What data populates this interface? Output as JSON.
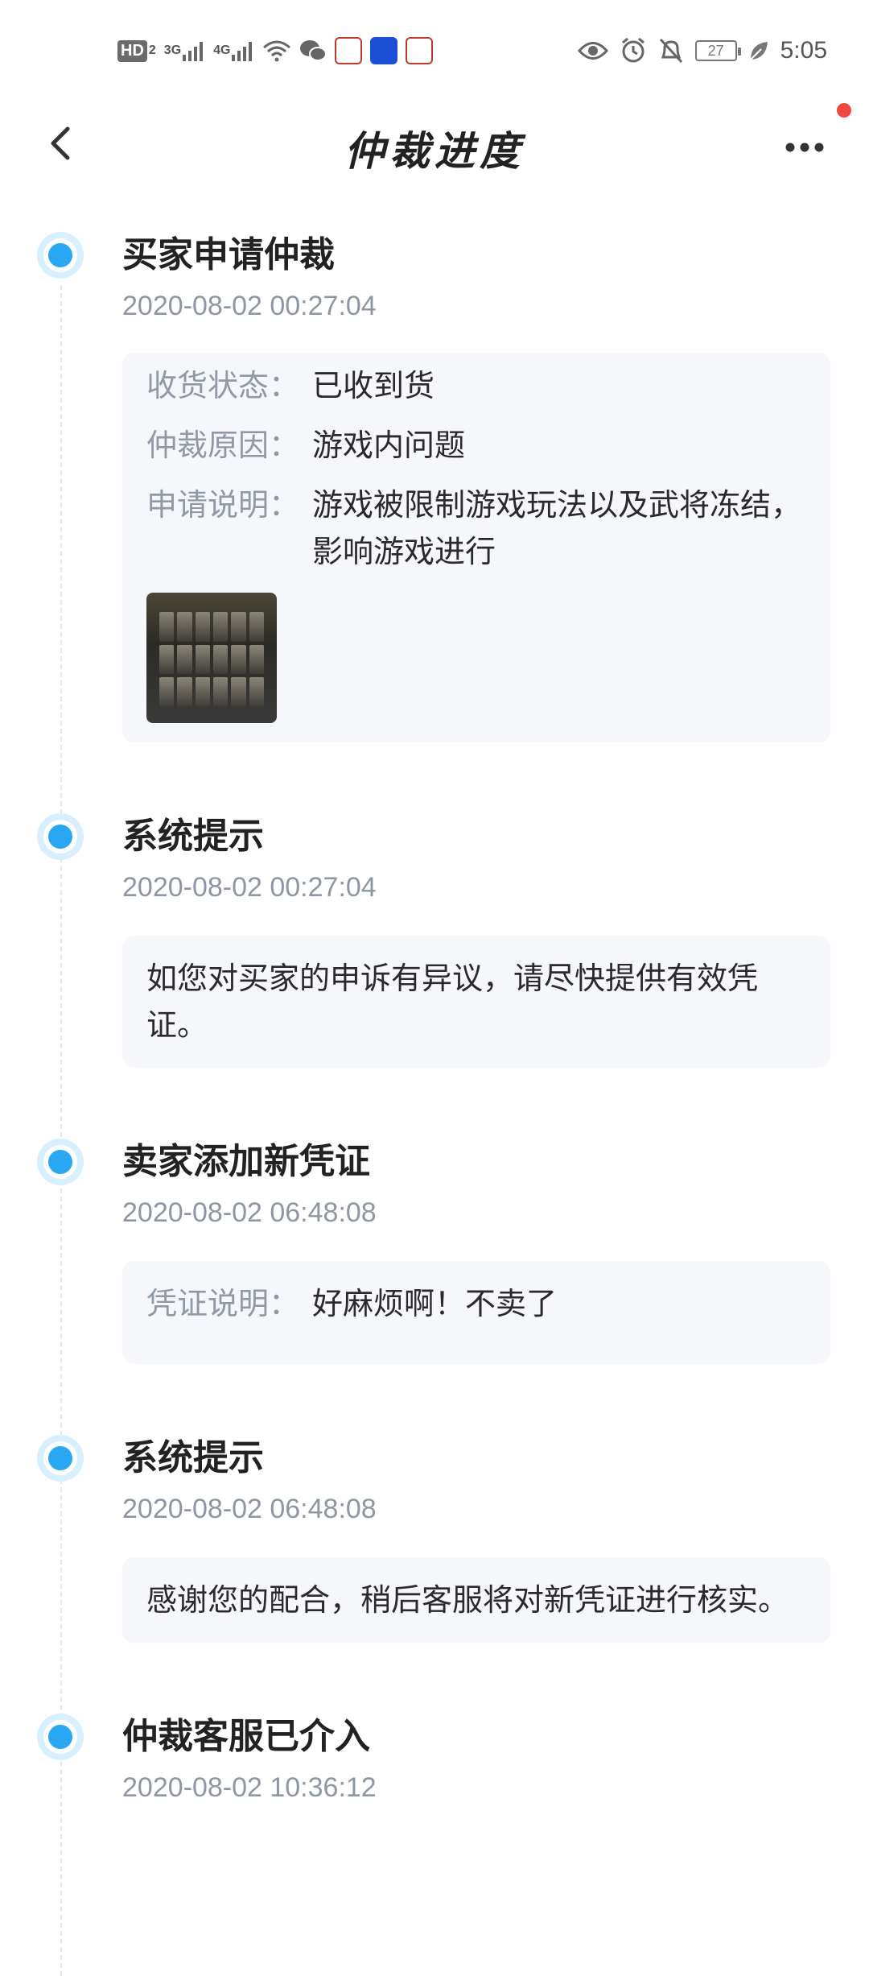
{
  "status_bar": {
    "hd_label": "HD",
    "hd_sub": "2",
    "net1": "3G",
    "net2": "4G",
    "battery": "27",
    "time": "5:05",
    "app_icon_colors": [
      "#c0392b",
      "#1a4fd6",
      "#c0392b"
    ]
  },
  "nav": {
    "title": "仲裁进度",
    "notification_dot_color": "#f0483e"
  },
  "accent_color": "#2aa7f2",
  "timeline": [
    {
      "title": "买家申请仲裁",
      "time": "2020-08-02 00:27:04",
      "fields": [
        {
          "label": "收货状态：",
          "value": "已收到货"
        },
        {
          "label": "仲裁原因：",
          "value": "游戏内问题"
        },
        {
          "label": "申请说明：",
          "value": "游戏被限制游戏玩法以及武将冻结，影响游戏进行"
        }
      ],
      "has_image": true
    },
    {
      "title": "系统提示",
      "time": "2020-08-02 00:27:04",
      "message": "如您对买家的申诉有异议，请尽快提供有效凭证。"
    },
    {
      "title": "卖家添加新凭证",
      "time": "2020-08-02 06:48:08",
      "fields": [
        {
          "label": "凭证说明：",
          "value": "好麻烦啊！不卖了"
        }
      ]
    },
    {
      "title": "系统提示",
      "time": "2020-08-02 06:48:08",
      "message": "感谢您的配合，稍后客服将对新凭证进行核实。"
    },
    {
      "title": "仲裁客服已介入",
      "time": "2020-08-02 10:36:12"
    }
  ]
}
